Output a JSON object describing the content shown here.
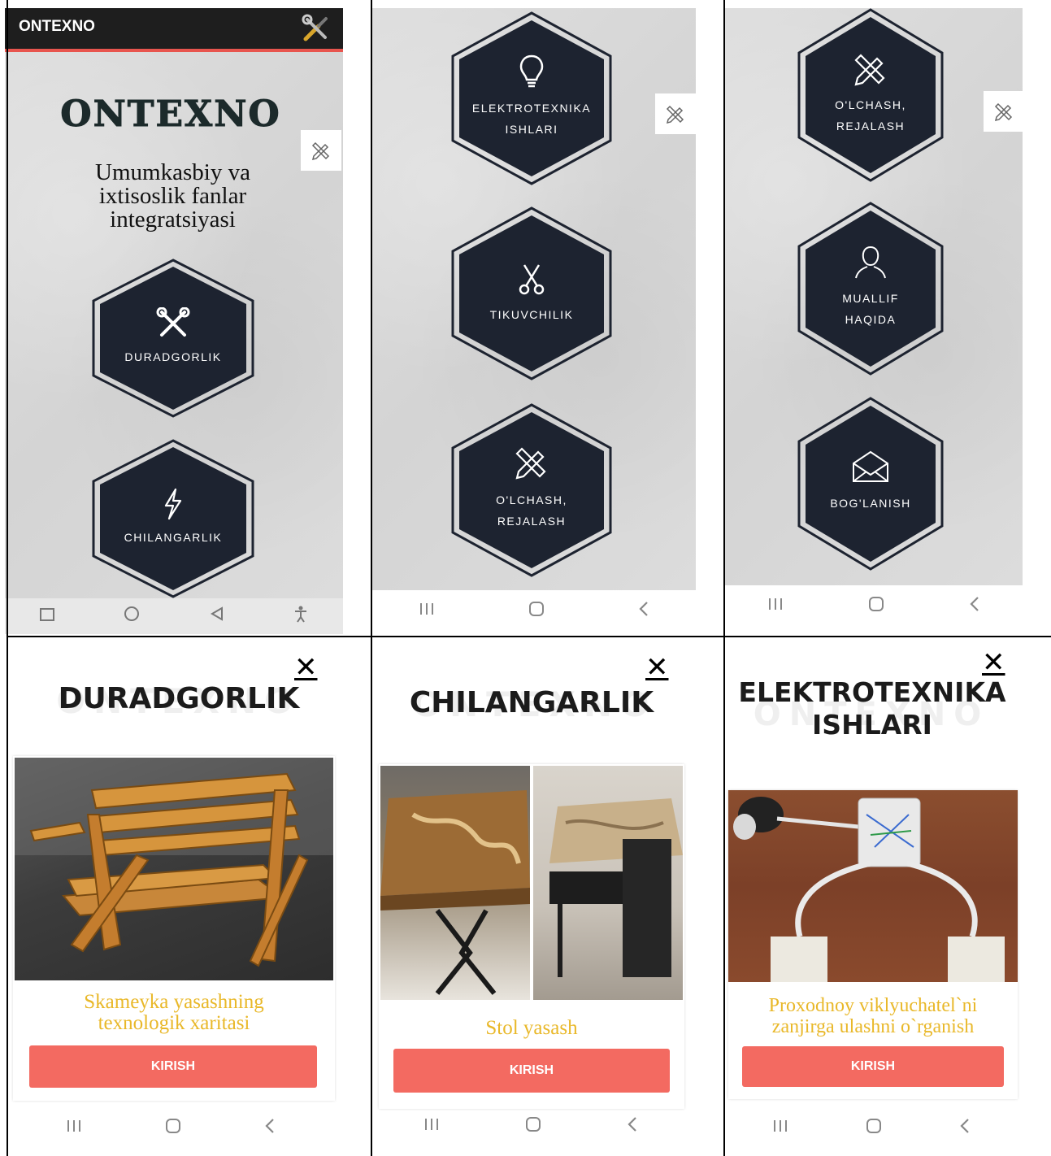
{
  "screen1": {
    "app_title": "ONTEXNO",
    "brand": "ONTEXNO",
    "subtitle_lines": [
      "Umumkasbiy va",
      "ixtisoslik fanlar",
      "integratsiyasi"
    ],
    "tiles": [
      {
        "label_lines": [
          "DURADGORLIK"
        ],
        "icon": "tools-icon"
      },
      {
        "label_lines": [
          "CHILANGARLIK"
        ],
        "icon": "lightning-icon"
      }
    ]
  },
  "screen2": {
    "tiles": [
      {
        "label_lines": [
          "ELEKTROTEXNIKA",
          "ISHLARI"
        ],
        "icon": "lightbulb-icon"
      },
      {
        "label_lines": [
          "TIKUVCHILIK"
        ],
        "icon": "scissors-icon"
      },
      {
        "label_lines": [
          "O'LCHASH,",
          "REJALASH"
        ],
        "icon": "pencil-ruler-icon"
      }
    ]
  },
  "screen3": {
    "tiles": [
      {
        "label_lines": [
          "O'LCHASH,",
          "REJALASH"
        ],
        "icon": "pencil-ruler-icon"
      },
      {
        "label_lines": [
          "MUALLIF",
          "HAQIDA"
        ],
        "icon": "user-icon"
      },
      {
        "label_lines": [
          "BOG'LANISH"
        ],
        "icon": "envelope-icon"
      }
    ]
  },
  "detail1": {
    "ghost": "ONTEXNO",
    "title_lines": [
      "DURADGORLIK"
    ],
    "caption_lines": [
      "Skameyka yasashning",
      "texnologik xaritasi"
    ],
    "button": "KIRISH"
  },
  "detail2": {
    "ghost": "ONTEXNO",
    "title_lines": [
      "CHILANGARLIK"
    ],
    "caption_lines": [
      "Stol yasash"
    ],
    "button": "KIRISH"
  },
  "detail3": {
    "ghost": "ONTEXNO",
    "title_lines": [
      "ELEKTROTEXNIKA",
      "ISHLARI"
    ],
    "caption_lines": [
      "Proxodnoy viklyuchatel`ni",
      "zanjirga ulashni o`rganish"
    ],
    "button": "KIRISH"
  },
  "close_glyph": "✕",
  "colors": {
    "hex_fill": "#1d2330",
    "accent": "#f36a61",
    "caption": "#e9b829",
    "appbar": "#1e1e1e"
  }
}
